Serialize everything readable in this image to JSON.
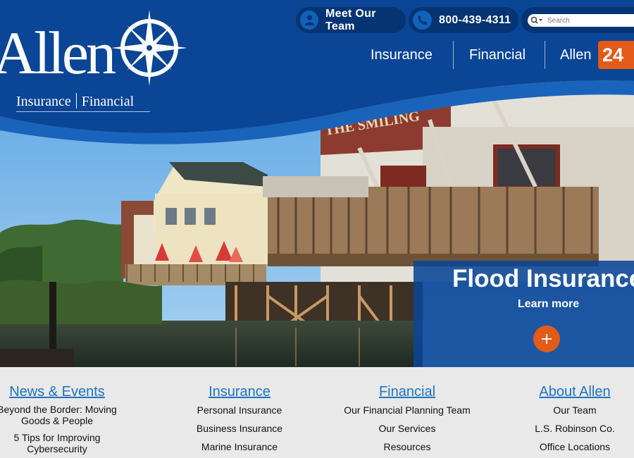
{
  "logo": {
    "wordmark": "Allen",
    "sub_left": "Insurance",
    "sub_right": "Financial"
  },
  "topbar": {
    "team_label": "Meet Our Team",
    "phone_label": "800-439-4311",
    "search_placeholder": "Search"
  },
  "nav": {
    "items": [
      "Insurance",
      "Financial",
      "Allen"
    ],
    "badge": "24"
  },
  "hero": {
    "sign_text": "THE SMILING",
    "promo_title": "Flood Insurance",
    "promo_link": "Learn more"
  },
  "footer": {
    "columns": [
      {
        "heading": "News & Events",
        "links": [
          "Beyond the Border: Moving Goods & People",
          "5 Tips for Improving Cybersecurity"
        ]
      },
      {
        "heading": "Insurance",
        "links": [
          "Personal Insurance",
          "Business Insurance",
          "Marine Insurance"
        ]
      },
      {
        "heading": "Financial",
        "links": [
          "Our Financial Planning Team",
          "Our Services",
          "Resources"
        ]
      },
      {
        "heading": "About Allen",
        "links": [
          "Our Team",
          "L.S. Robinson Co.",
          "Office Locations"
        ]
      }
    ]
  },
  "colors": {
    "brand_blue": "#0a4596",
    "dark_blue": "#063473",
    "accent_orange": "#e35b18",
    "link_blue": "#1f73c2"
  },
  "icons": {
    "team": "team-icon",
    "phone": "phone-icon",
    "search": "search-icon",
    "plus": "plus-icon",
    "compass": "compass-rose-icon"
  }
}
